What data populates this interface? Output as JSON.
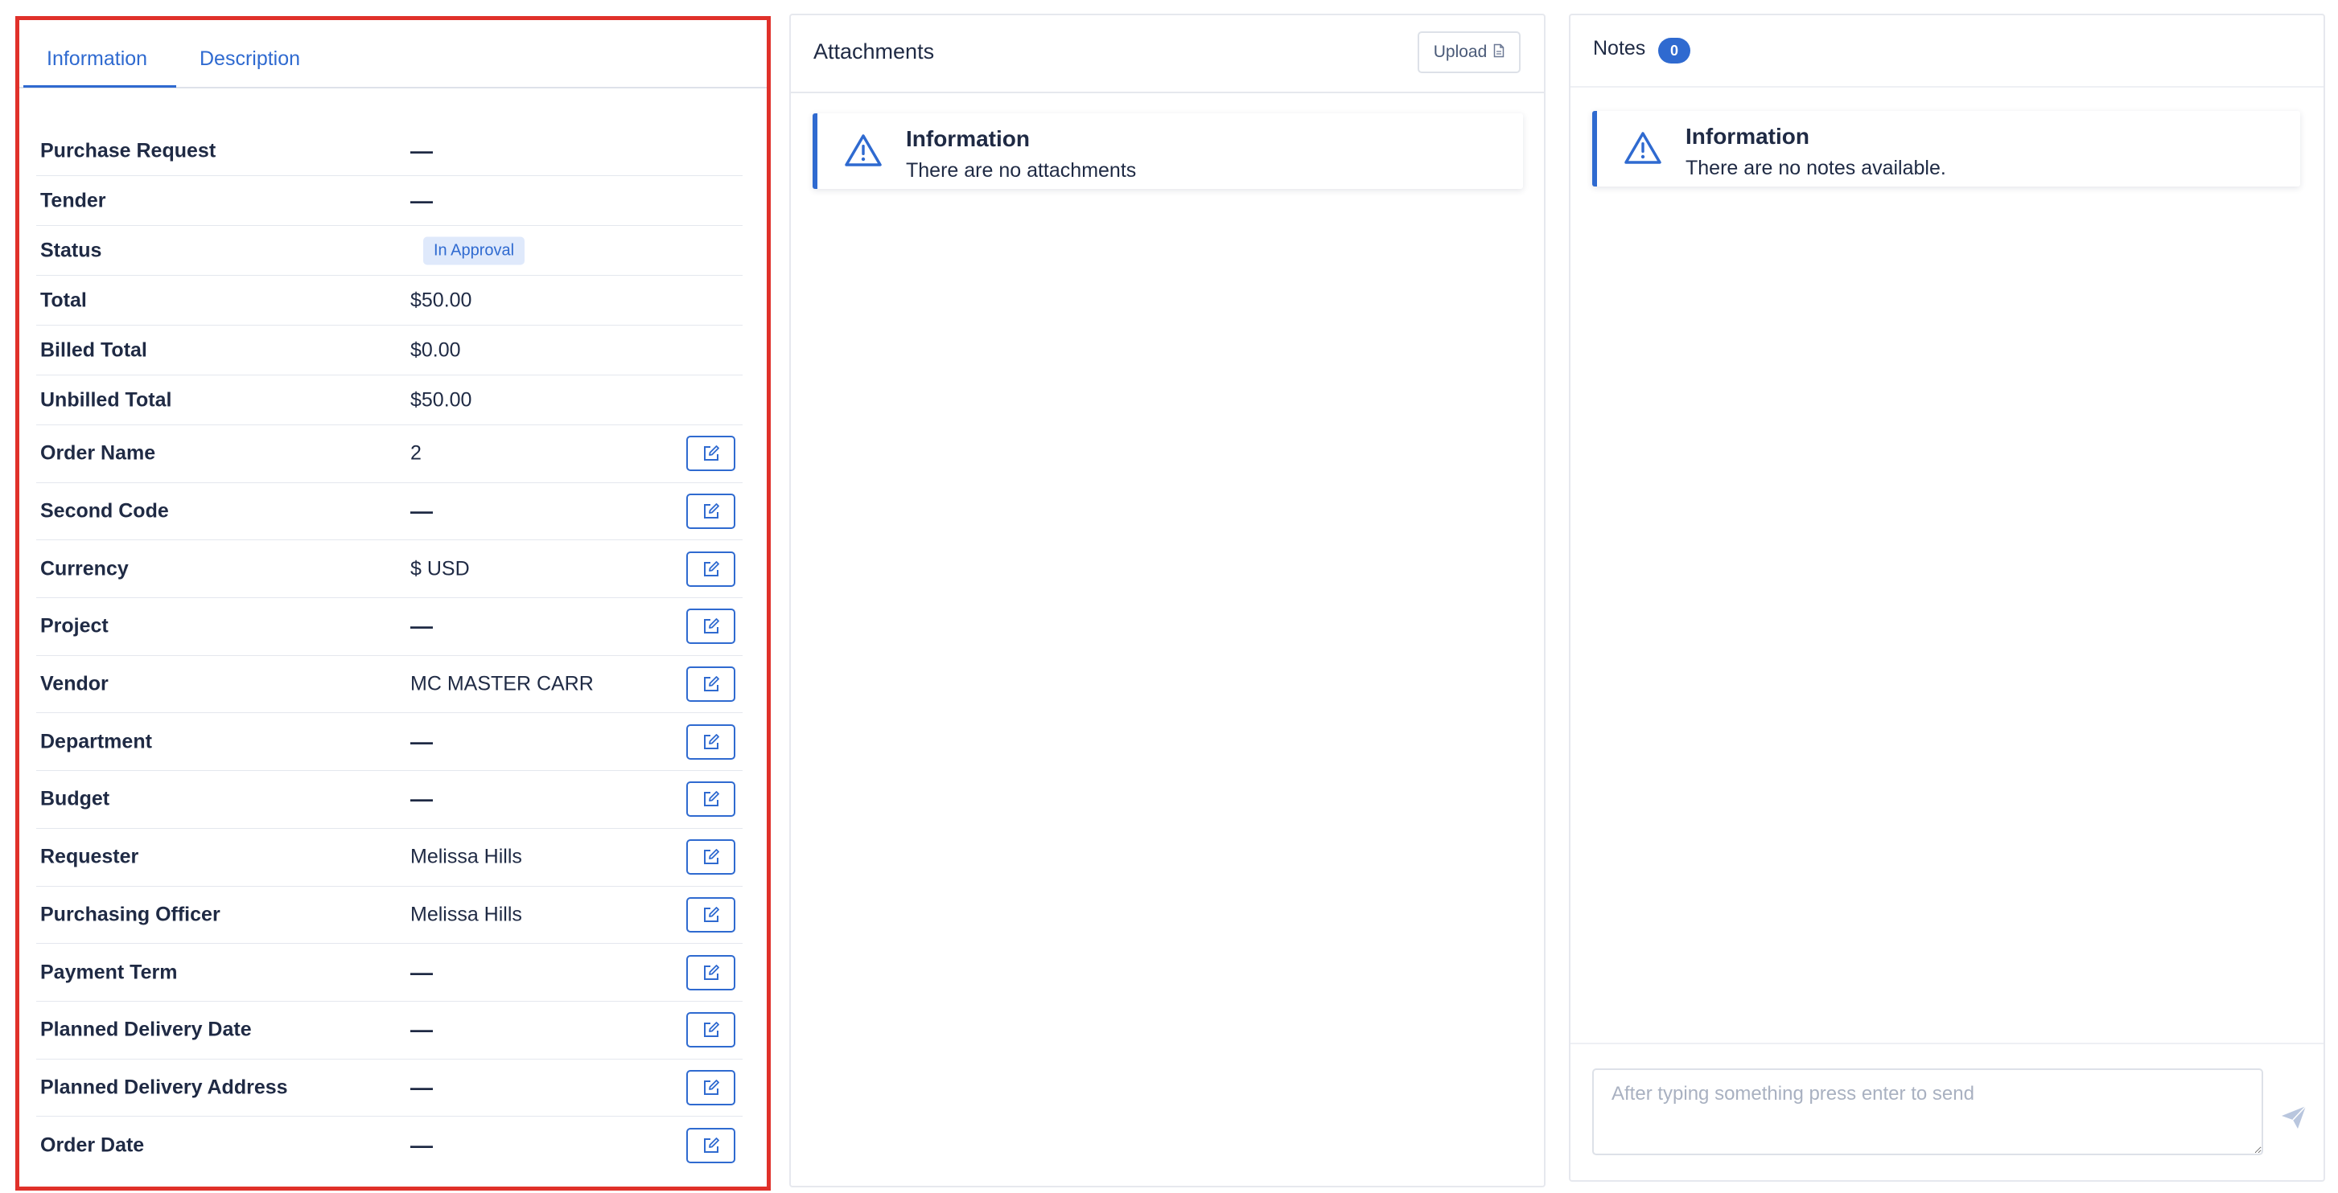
{
  "info_panel": {
    "tabs": [
      {
        "label": "Information",
        "active": true
      },
      {
        "label": "Description",
        "active": false
      }
    ],
    "rows": [
      {
        "label": "Purchase Request",
        "value": "—",
        "editable": false
      },
      {
        "label": "Tender",
        "value": "—",
        "editable": false
      },
      {
        "label": "Status",
        "value": "In Approval",
        "editable": false,
        "badge": true
      },
      {
        "label": "Total",
        "value": "$50.00",
        "editable": false
      },
      {
        "label": "Billed Total",
        "value": "$0.00",
        "editable": false
      },
      {
        "label": "Unbilled Total",
        "value": "$50.00",
        "editable": false
      },
      {
        "label": "Order Name",
        "value": "2",
        "editable": true
      },
      {
        "label": "Second Code",
        "value": "—",
        "editable": true
      },
      {
        "label": "Currency",
        "value": "$ USD",
        "editable": true
      },
      {
        "label": "Project",
        "value": "—",
        "editable": true
      },
      {
        "label": "Vendor",
        "value": "MC MASTER CARR",
        "editable": true
      },
      {
        "label": "Department",
        "value": "—",
        "editable": true
      },
      {
        "label": "Budget",
        "value": "—",
        "editable": true
      },
      {
        "label": "Requester",
        "value": "Melissa Hills",
        "editable": true
      },
      {
        "label": "Purchasing Officer",
        "value": "Melissa Hills",
        "editable": true
      },
      {
        "label": "Payment Term",
        "value": "—",
        "editable": true
      },
      {
        "label": "Planned Delivery Date",
        "value": "—",
        "editable": true
      },
      {
        "label": "Planned Delivery Address",
        "value": "—",
        "editable": true
      },
      {
        "label": "Order Date",
        "value": "—",
        "editable": true
      }
    ],
    "edit_icon": "edit-icon"
  },
  "attachments": {
    "title": "Attachments",
    "upload_label": "Upload",
    "upload_icon": "file-icon",
    "alert": {
      "icon": "warning-triangle-icon",
      "title": "Information",
      "text": "There are no attachments"
    }
  },
  "notes": {
    "title": "Notes",
    "count": "0",
    "alert": {
      "icon": "warning-triangle-icon",
      "title": "Information",
      "text": "There are no notes available."
    },
    "input_placeholder": "After typing something press enter to send",
    "input_value": "",
    "send_icon": "send-icon"
  },
  "colors": {
    "accent": "#2f6ad0",
    "highlight_border": "#e0312a",
    "text": "#1f2a44",
    "badge_bg": "#dfe9fb",
    "placeholder": "#a9b1c1"
  }
}
